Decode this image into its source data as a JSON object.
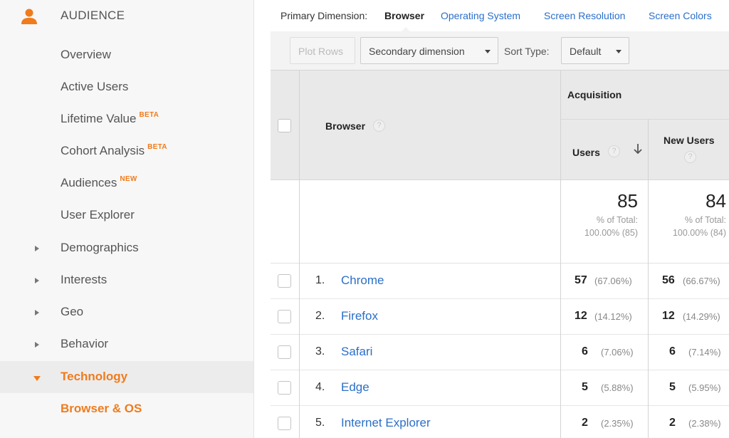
{
  "sidebar": {
    "section_title": "AUDIENCE",
    "items": [
      {
        "label": "Overview",
        "badge": ""
      },
      {
        "label": "Active Users",
        "badge": ""
      },
      {
        "label": "Lifetime Value",
        "badge": "BETA"
      },
      {
        "label": "Cohort Analysis",
        "badge": "BETA"
      },
      {
        "label": "Audiences",
        "badge": "NEW"
      },
      {
        "label": "User Explorer",
        "badge": ""
      },
      {
        "label": "Demographics",
        "badge": ""
      },
      {
        "label": "Interests",
        "badge": ""
      },
      {
        "label": "Geo",
        "badge": ""
      },
      {
        "label": "Behavior",
        "badge": ""
      },
      {
        "label": "Technology",
        "badge": ""
      },
      {
        "label": "Browser & OS",
        "badge": ""
      }
    ]
  },
  "dimensions": {
    "label": "Primary Dimension:",
    "current": "Browser",
    "links": [
      "Operating System",
      "Screen Resolution",
      "Screen Colors"
    ]
  },
  "toolbar": {
    "plot_rows": "Plot Rows",
    "secondary_dimension": "Secondary dimension",
    "sort_type_label": "Sort Type:",
    "sort_type_value": "Default"
  },
  "table": {
    "dimension_header": "Browser",
    "group_header": "Acquisition",
    "columns": [
      "Users",
      "New Users"
    ],
    "totals": {
      "users": "85",
      "users_pct_label": "% of Total:",
      "users_pct": "100.00% (85)",
      "new_users": "84",
      "new_users_pct_label": "% of Total:",
      "new_users_pct": "100.00% (84)"
    },
    "rows": [
      {
        "rank": "1.",
        "name": "Chrome",
        "users": "57",
        "users_pct": "(67.06%)",
        "new_users": "56",
        "new_users_pct": "(66.67%)"
      },
      {
        "rank": "2.",
        "name": "Firefox",
        "users": "12",
        "users_pct": "(14.12%)",
        "new_users": "12",
        "new_users_pct": "(14.29%)"
      },
      {
        "rank": "3.",
        "name": "Safari",
        "users": "6",
        "users_pct": "(7.06%)",
        "new_users": "6",
        "new_users_pct": "(7.14%)"
      },
      {
        "rank": "4.",
        "name": "Edge",
        "users": "5",
        "users_pct": "(5.88%)",
        "new_users": "5",
        "new_users_pct": "(5.95%)"
      },
      {
        "rank": "5.",
        "name": "Internet Explorer",
        "users": "2",
        "users_pct": "(2.35%)",
        "new_users": "2",
        "new_users_pct": "(2.38%)"
      }
    ]
  },
  "colors": {
    "accent": "#f07b1d",
    "link": "#2a6fc9"
  }
}
